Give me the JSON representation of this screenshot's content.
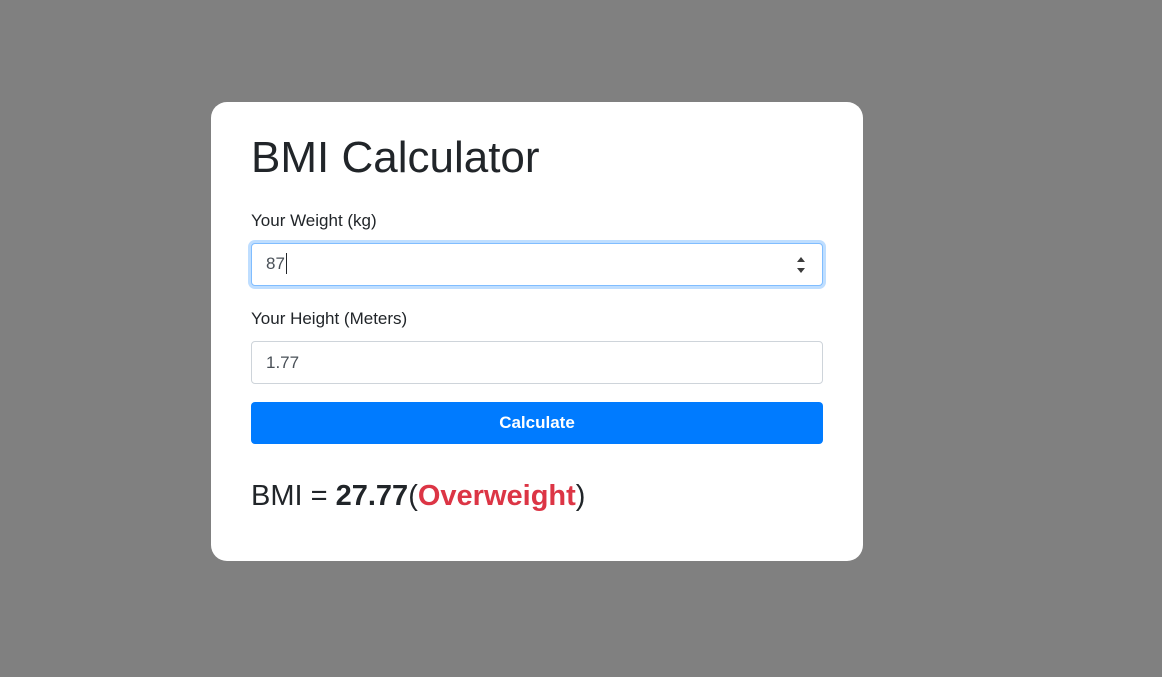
{
  "card": {
    "title": "BMI Calculator",
    "weight": {
      "label": "Your Weight (kg)",
      "value": "87"
    },
    "height": {
      "label": "Your Height (Meters)",
      "value": "1.77"
    },
    "calculate_label": "Calculate",
    "result": {
      "prefix": "BMI = ",
      "value": "27.77",
      "open_paren": "(",
      "category": "Overweight",
      "close_paren": ")"
    }
  },
  "colors": {
    "background": "#808080",
    "card": "#ffffff",
    "accent": "#007bff",
    "danger": "#dc3545"
  },
  "icons": {
    "weight_spinner": "number-spinner-icon"
  }
}
